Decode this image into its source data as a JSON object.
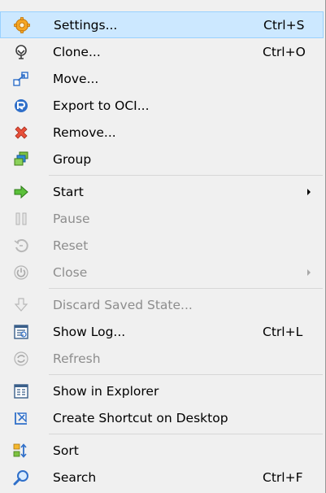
{
  "menu": {
    "items": [
      {
        "label": "Settings...",
        "shortcut": "Ctrl+S",
        "icon": "settings-icon",
        "enabled": true,
        "highlighted": true
      },
      {
        "label": "Clone...",
        "shortcut": "Ctrl+O",
        "icon": "clone-icon",
        "enabled": true
      },
      {
        "label": "Move...",
        "shortcut": "",
        "icon": "move-icon",
        "enabled": true
      },
      {
        "label": "Export to OCI...",
        "shortcut": "",
        "icon": "export-oci-icon",
        "enabled": true
      },
      {
        "label": "Remove...",
        "shortcut": "",
        "icon": "remove-icon",
        "enabled": true
      },
      {
        "label": "Group",
        "shortcut": "",
        "icon": "group-icon",
        "enabled": true
      },
      {
        "label": "Start",
        "shortcut": "",
        "icon": "start-arrow-icon",
        "enabled": true,
        "submenu": true
      },
      {
        "label": "Pause",
        "shortcut": "",
        "icon": "pause-icon",
        "enabled": false
      },
      {
        "label": "Reset",
        "shortcut": "",
        "icon": "reset-icon",
        "enabled": false
      },
      {
        "label": "Close",
        "shortcut": "",
        "icon": "power-icon",
        "enabled": false,
        "submenu": true
      },
      {
        "label": "Discard Saved State...",
        "shortcut": "",
        "icon": "discard-arrow-icon",
        "enabled": false
      },
      {
        "label": "Show Log...",
        "shortcut": "Ctrl+L",
        "icon": "log-icon",
        "enabled": true
      },
      {
        "label": "Refresh",
        "shortcut": "",
        "icon": "refresh-icon",
        "enabled": false
      },
      {
        "label": "Show in Explorer",
        "shortcut": "",
        "icon": "explorer-icon",
        "enabled": true
      },
      {
        "label": "Create Shortcut on Desktop",
        "shortcut": "",
        "icon": "shortcut-icon",
        "enabled": true
      },
      {
        "label": "Sort",
        "shortcut": "",
        "icon": "sort-icon",
        "enabled": true
      },
      {
        "label": "Search",
        "shortcut": "Ctrl+F",
        "icon": "search-icon",
        "enabled": true
      }
    ]
  },
  "colors": {
    "highlight_bg": "#cce8ff",
    "highlight_border": "#99d1ff",
    "menu_bg": "#f0f0f0",
    "disabled_text": "#8d8d8d"
  }
}
